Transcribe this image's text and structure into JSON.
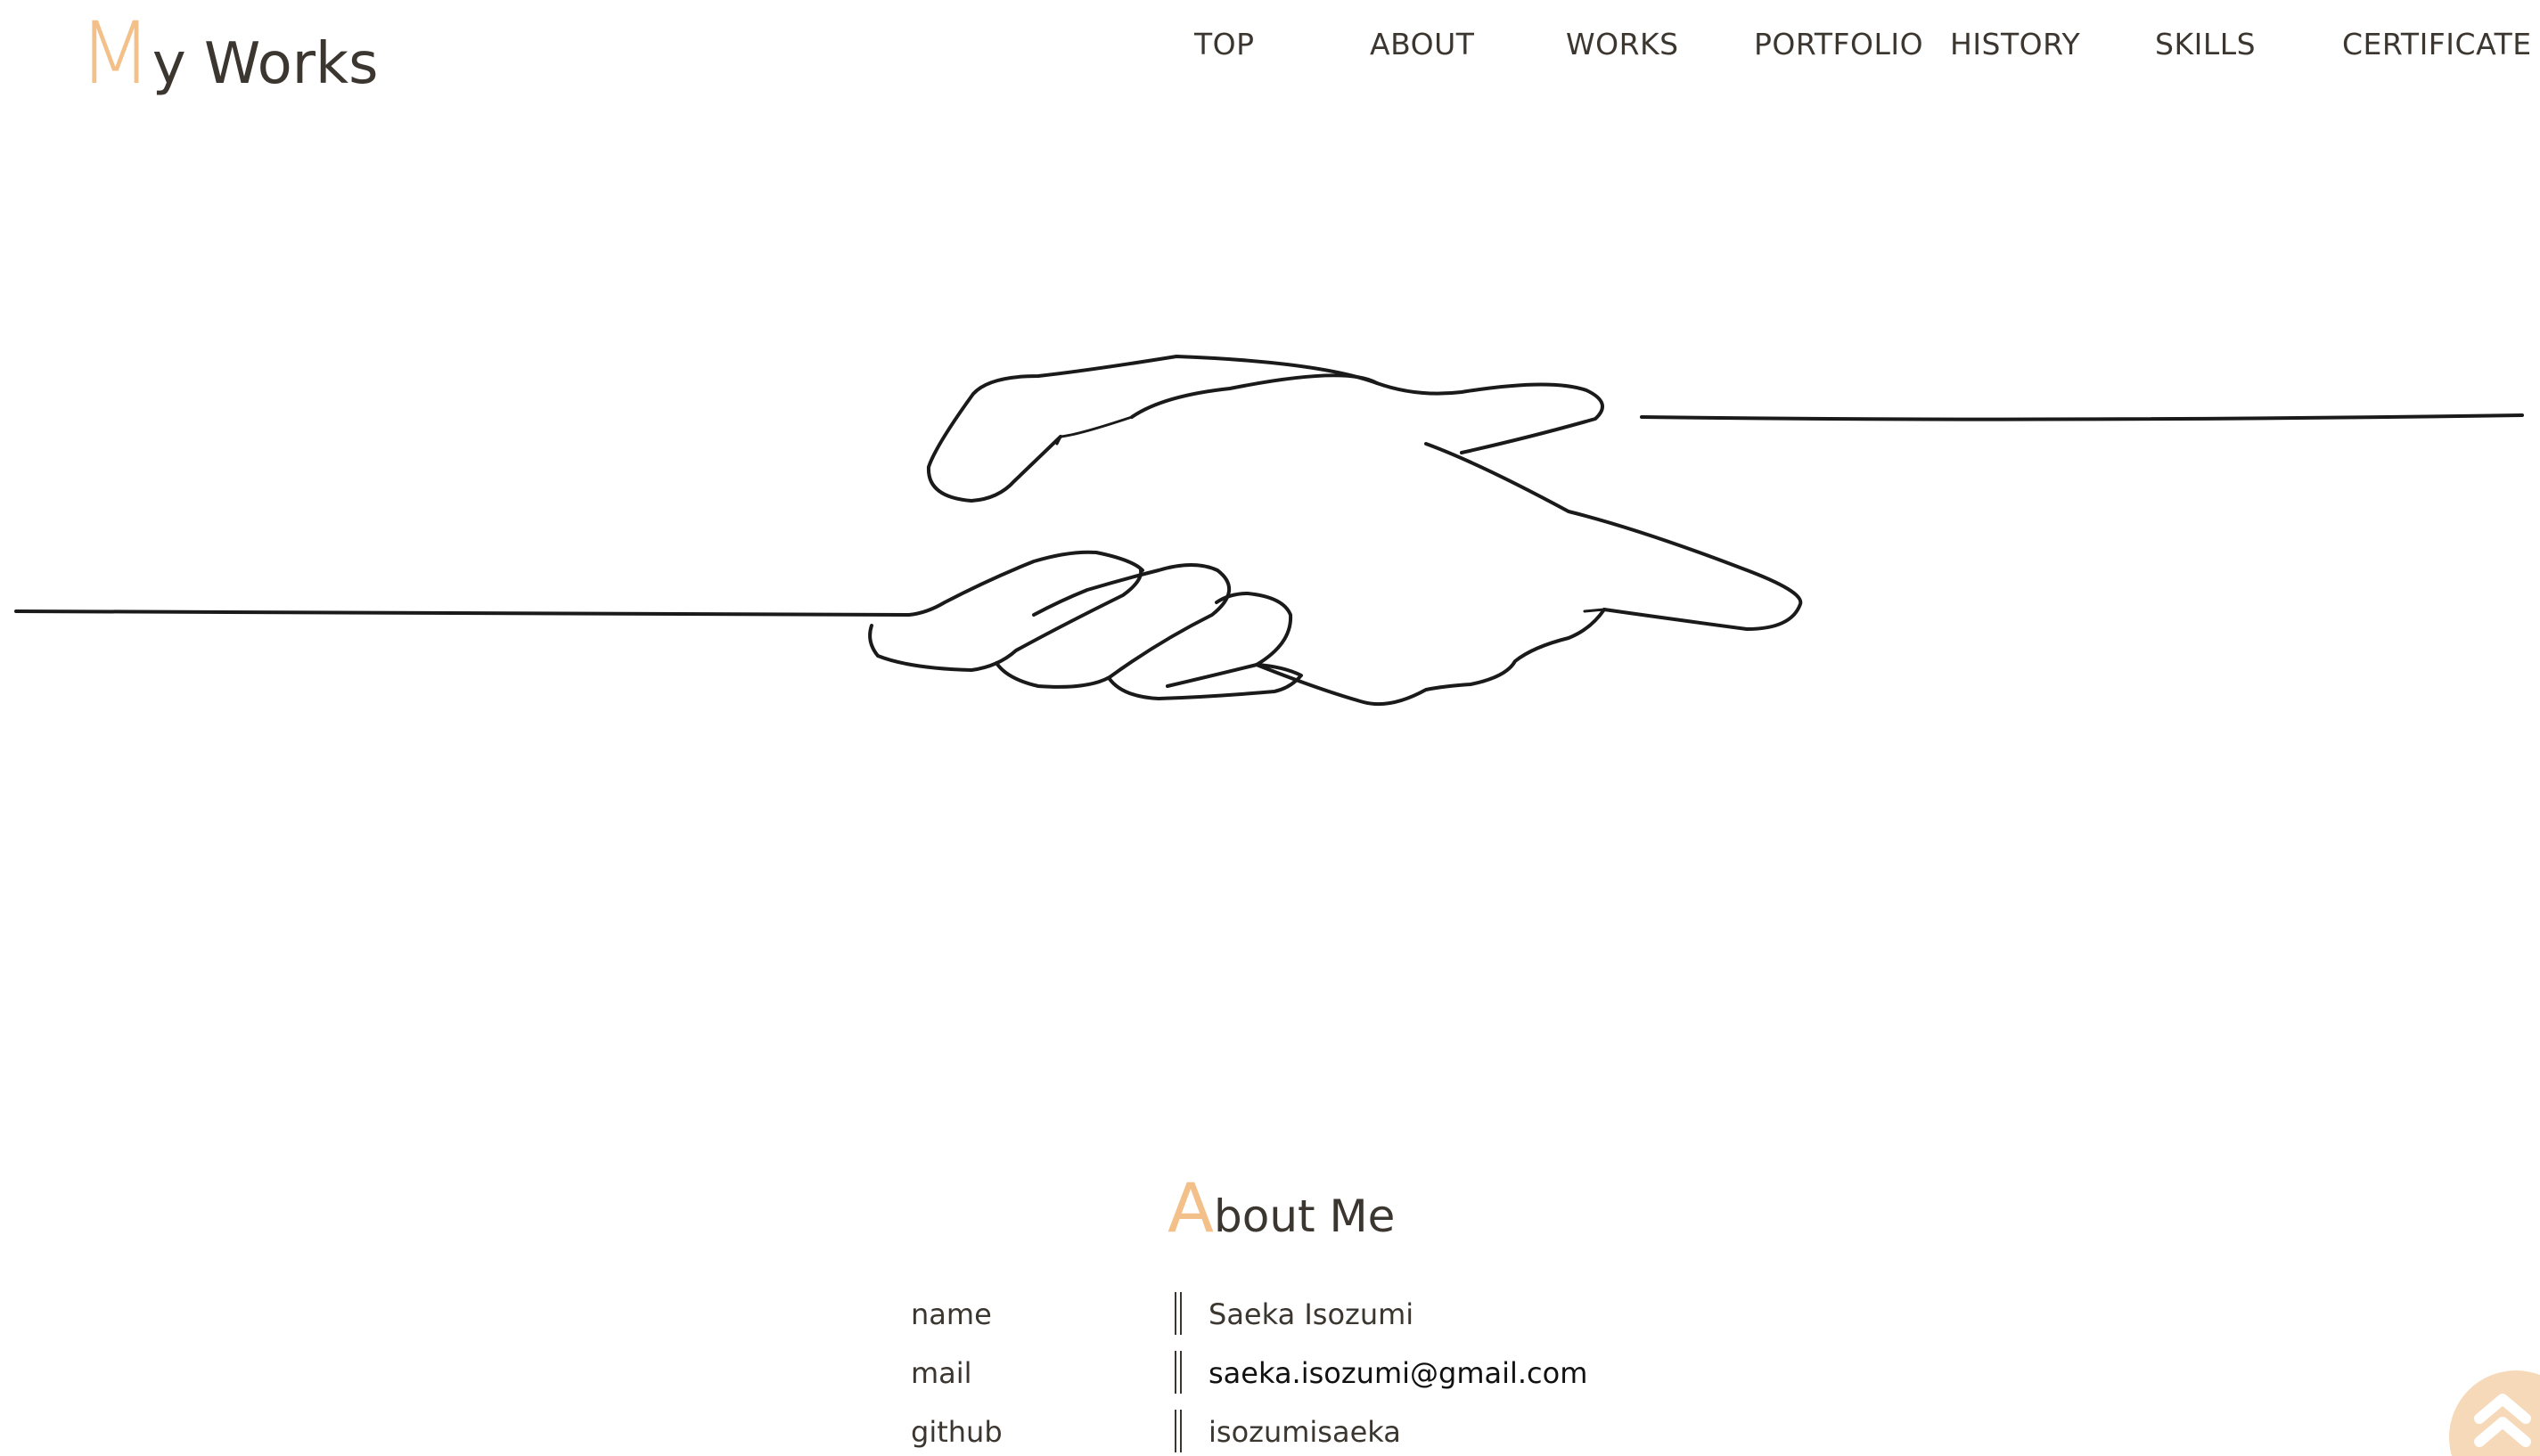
{
  "header": {
    "logo_initial": "M",
    "logo_rest": "y Works",
    "nav": [
      "TOP",
      "ABOUT",
      "WORKS",
      "PORTFOLIO",
      "HISTORY",
      "SKILLS",
      "CERTIFICATE"
    ]
  },
  "hero": {
    "image": "handshake-line-drawing"
  },
  "about": {
    "title_initial": "A",
    "title_rest": "bout Me",
    "rows": [
      {
        "label": "name",
        "value": "Saeka Isozumi"
      },
      {
        "label": "mail",
        "value": "saeka.isozumi@gmail.com"
      },
      {
        "label": "github",
        "value": "isozumisaeka"
      }
    ]
  },
  "scroll_top": {
    "icon": "double-chevron-up-icon"
  },
  "colors": {
    "accent": "#f3c08a",
    "scroll_button": "#f6d9b8",
    "text": "#3c3630"
  }
}
